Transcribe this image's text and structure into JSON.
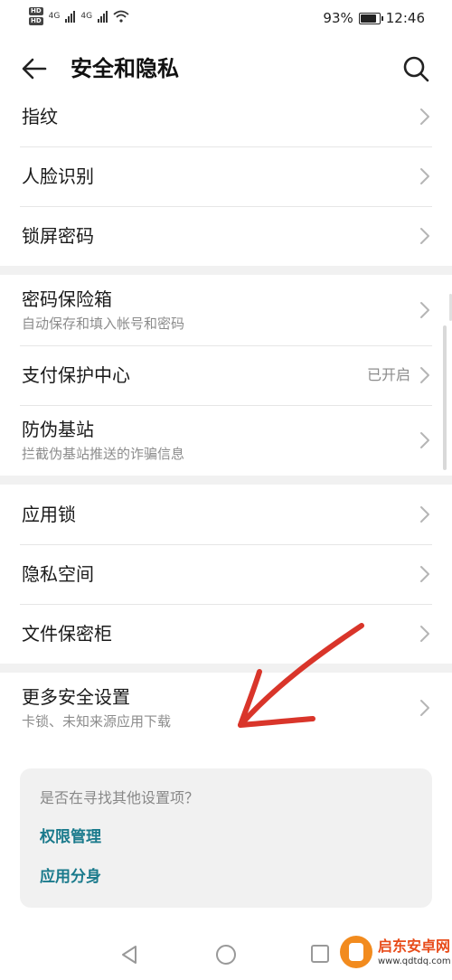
{
  "status": {
    "hd1": "HD",
    "hd2": "HD",
    "net1": "4G",
    "net2": "4G",
    "battery": "93%",
    "time": "12:46",
    "battery_level": 0.93
  },
  "appbar": {
    "title": "安全和隐私",
    "back_icon": "arrow-left-icon",
    "search_icon": "search-icon"
  },
  "groups": [
    [
      {
        "title": "指纹"
      },
      {
        "title": "人脸识别"
      },
      {
        "title": "锁屏密码"
      }
    ],
    [
      {
        "title": "密码保险箱",
        "sub": "自动保存和填入帐号和密码"
      },
      {
        "title": "支付保护中心",
        "status": "已开启"
      },
      {
        "title": "防伪基站",
        "sub": "拦截伪基站推送的诈骗信息"
      }
    ],
    [
      {
        "title": "应用锁"
      },
      {
        "title": "隐私空间"
      },
      {
        "title": "文件保密柜"
      }
    ],
    [
      {
        "title": "更多安全设置",
        "sub": "卡锁、未知来源应用下载"
      }
    ]
  ],
  "suggest": {
    "title": "是否在寻找其他设置项？",
    "links": [
      "权限管理",
      "应用分身"
    ]
  },
  "watermark": {
    "name": "启东安卓网",
    "url": "www.qdtdq.com"
  },
  "colors": {
    "accent_link": "#1a7a8c",
    "annotation_arrow": "#d9352a",
    "separator": "#f1f1f1"
  }
}
